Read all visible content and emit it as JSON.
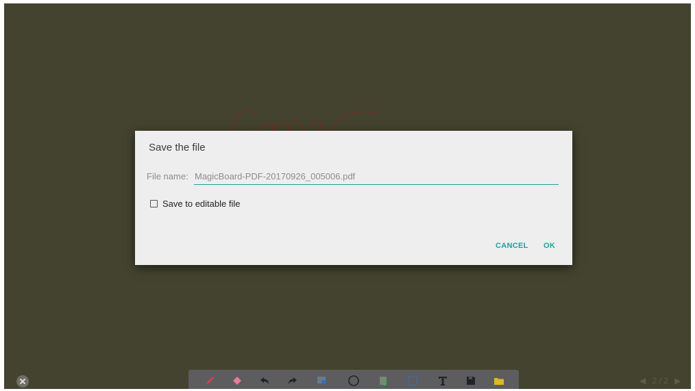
{
  "dialog": {
    "title": "Save the file",
    "file_label": "File name:",
    "file_value": "MagicBoard-PDF-20170926_005006.pdf",
    "checkbox_label": "Save to editable file",
    "checkbox_checked": false,
    "cancel_label": "CANCEL",
    "ok_label": "OK"
  },
  "toolbar": {
    "tools": [
      "pen-icon",
      "eraser-icon",
      "undo-icon",
      "redo-icon",
      "background-icon",
      "shape-circle-icon",
      "insert-image-icon",
      "select-icon",
      "text-icon",
      "save-icon",
      "folder-icon"
    ]
  },
  "pager": {
    "current": "2",
    "total": "2",
    "display": "2 / 2"
  },
  "colors": {
    "board": "#43432f",
    "accent": "#1e9ea1",
    "ink": "#7a2c24"
  }
}
